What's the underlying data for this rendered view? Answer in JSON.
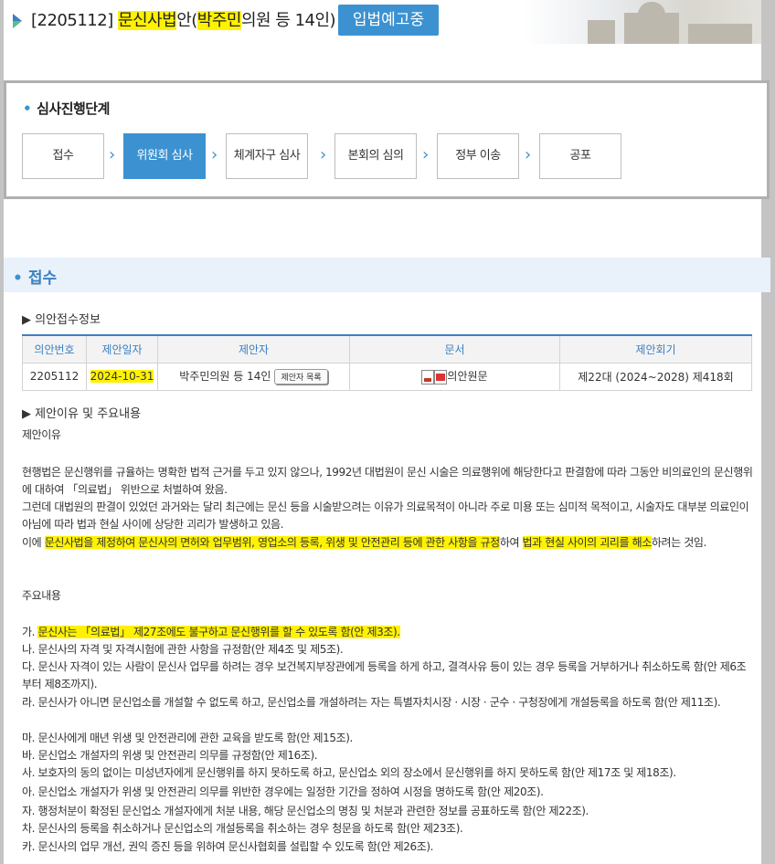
{
  "header": {
    "bill_prefix": "[2205112] ",
    "bill_name_hl": "문신사법",
    "bill_name_rest": "안(",
    "proposer_hl": "박주민",
    "proposer_rest": "의원 등 14인)",
    "status": "입법예고중"
  },
  "stages": {
    "title": "심사진행단계",
    "steps": [
      "접수",
      "위원회 심사",
      "체계자구 심사",
      "본회의 심의",
      "정부 이송",
      "공포"
    ],
    "active_index": 1
  },
  "section": {
    "title": "접수",
    "receipt_info_title": "의안접수정보",
    "reason_title": "제안이유 및 주요내용"
  },
  "table": {
    "headers": [
      "의안번호",
      "제안일자",
      "제안자",
      "문서",
      "제안회기"
    ],
    "row": {
      "bill_no": "2205112",
      "date": "2024-10-31",
      "proposer": "박주민의원 등 14인",
      "proposer_list_button": "제안자 목록",
      "document": "의안원문",
      "session": "제22대 (2024~2028) 제418회"
    }
  },
  "content": {
    "reason_heading": "제안이유",
    "p1": "현행법은 문신행위를 규율하는 명확한 법적 근거를 두고 있지 않으나, 1992년 대법원이 문신 시술은 의료행위에 해당한다고 판결함에 따라 그동안 비의료인의 문신행위에 대하여 「의료법」 위반으로 처벌하여 왔음.",
    "p2": "그런데 대법원의 판결이 있었던 과거와는 달리 최근에는 문신 등을 시술받으려는 이유가 의료목적이 아니라 주로 미용 또는 심미적 목적이고, 시술자도 대부분 의료인이 아님에 따라 법과 현실 사이에 상당한 괴리가 발생하고 있음.",
    "p3_a": "이에 ",
    "p3_hl1": "문신사법을 제정하여 문신사의 면허와 업무범위, 영업소의 등록, 위생 및 안전관리 등에 관한 사항을 규정",
    "p3_b": "하여 ",
    "p3_hl2": "법과 현실 사이의 괴리를 해소",
    "p3_c": "하려는 것임.",
    "main_heading": "주요내용",
    "item_ga_a": "가. ",
    "item_ga_hl": "문신사는 「의료법」 제27조에도 불구하고 문신행위를 할 수 있도록 함(안 제3조).",
    "items": [
      "나. 문신사의 자격 및 자격시험에 관한 사항을 규정함(안 제4조 및 제5조).",
      "다. 문신사 자격이 있는 사람이 문신사 업무를 하려는 경우 보건복지부장관에게 등록을 하게 하고, 결격사유 등이 있는 경우 등록을 거부하거나 취소하도록 함(안 제6조부터 제8조까지).",
      "라. 문신사가 아니면 문신업소를 개설할 수 없도록 하고, 문신업소를 개설하려는 자는 특별자치시장 · 시장 · 군수 · 구청장에게 개설등록을 하도록 함(안 제11조).",
      "마. 문신사에게 매년 위생 및 안전관리에 관한 교육을 받도록 함(안 제15조).",
      "바. 문신업소 개설자의 위생 및 안전관리 의무를 규정함(안 제16조).",
      "사. 보호자의 동의 없이는 미성년자에게 문신행위를 하지 못하도록 하고, 문신업소 외의 장소에서 문신행위를 하지 못하도록 함(안 제17조 및 제18조).",
      "아. 문신업소 개설자가 위생 및 안전관리 의무를 위반한 경우에는 일정한 기간을 정하여 시정을 명하도록 함(안 제20조).",
      "자. 행정처분이 확정된 문신업소 개설자에게 처분 내용, 해당 문신업소의 명칭 및 처분과 관련한 정보를 공표하도록 함(안 제22조).",
      "차. 문신사의 등록을 취소하거나 문신업소의 개설등록을 취소하는 경우 청문을 하도록 함(안 제23조).",
      "카. 문신사의 업무 개선, 권익 증진 등을 위하여 문신사협회를 설립할 수 있도록 함(안 제26조)."
    ]
  }
}
